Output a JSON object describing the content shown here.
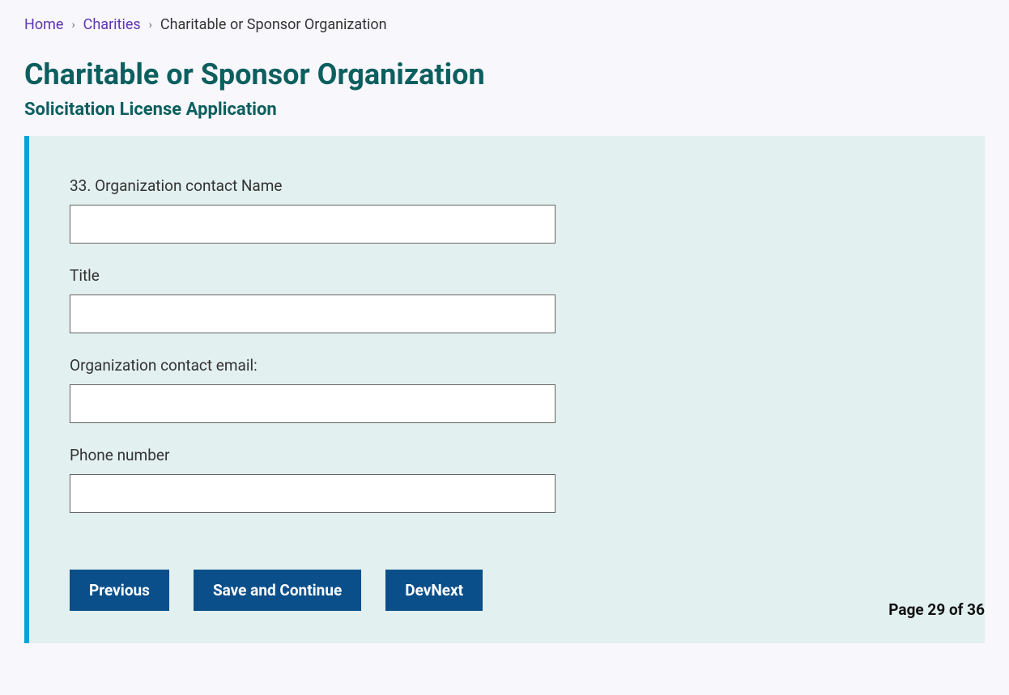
{
  "breadcrumb": {
    "home": "Home",
    "charities": "Charities",
    "current": "Charitable or Sponsor Organization"
  },
  "title": "Charitable or Sponsor Organization",
  "subtitle": "Solicitation License Application",
  "form": {
    "fields": [
      {
        "label": "33. Organization contact Name",
        "value": ""
      },
      {
        "label": "Title",
        "value": ""
      },
      {
        "label": "Organization contact email:",
        "value": ""
      },
      {
        "label": "Phone number",
        "value": ""
      }
    ]
  },
  "buttons": {
    "previous": "Previous",
    "save_continue": "Save and Continue",
    "dev_next": "DevNext"
  },
  "pager": "Page 29 of 36"
}
